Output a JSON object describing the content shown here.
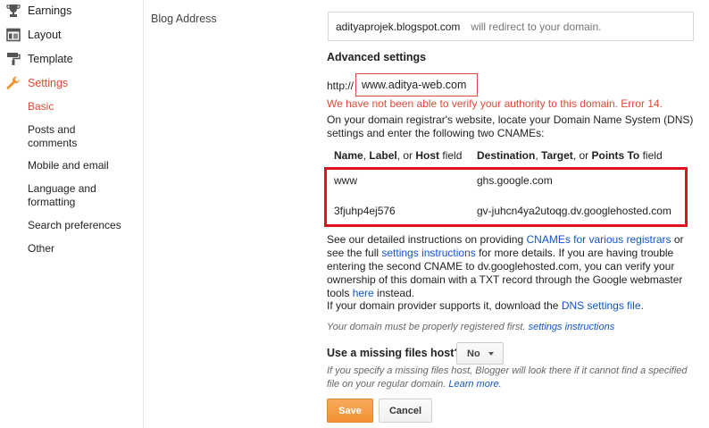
{
  "sidebar": {
    "items": [
      {
        "label": "Earnings",
        "icon": "trophy-icon"
      },
      {
        "label": "Layout",
        "icon": "layout-icon"
      },
      {
        "label": "Template",
        "icon": "paint-roller-icon"
      },
      {
        "label": "Settings",
        "icon": "wrench-icon"
      }
    ],
    "subitems": [
      {
        "label": "Basic"
      },
      {
        "label": "Posts and comments"
      },
      {
        "label": "Mobile and email"
      },
      {
        "label": "Language and formatting"
      },
      {
        "label": "Search preferences"
      },
      {
        "label": "Other"
      }
    ]
  },
  "blog_address": {
    "label": "Blog Address",
    "subdomain": "adityaprojek.blogspot.com",
    "redirect_note": "will redirect to your domain."
  },
  "advanced": {
    "title": "Advanced settings",
    "http_prefix": "http://",
    "domain_value": "www.aditya-web.com",
    "error": "We have not been able to verify your authority to this domain. Error 14.",
    "instructions": "On your domain registrar's website, locate your Domain Name System (DNS) settings and enter the following two CNAMEs:",
    "table": {
      "head_name_b1": "Name",
      "head_name_t1": ", ",
      "head_name_b2": "Label",
      "head_name_t2": ", or ",
      "head_name_b3": "Host",
      "head_name_t3": " field",
      "head_dest_b1": "Destination",
      "head_dest_t1": ", ",
      "head_dest_b2": "Target",
      "head_dest_t2": ", or ",
      "head_dest_b3": "Points To",
      "head_dest_t3": " field",
      "rows": [
        {
          "name": "www",
          "dest": "ghs.google.com"
        },
        {
          "name": "3fjuhp4ej576",
          "dest": "gv-juhcn4ya2utoqg.dv.googlehosted.com"
        }
      ]
    },
    "detail_p1": "See our detailed instructions on providing ",
    "detail_link1": "CNAMEs for various registrars",
    "detail_p2": " or see the full ",
    "detail_link2": "settings instructions",
    "detail_p3": " for more details. If you are having trouble entering the second CNAME to dv.googlehosted.com, you can verify your ownership of this domain with a TXT record through the Google webmaster tools ",
    "detail_link3": "here",
    "detail_p4": " instead.",
    "dns_p1": "If your domain provider supports it, download the ",
    "dns_link": "DNS settings file",
    "dns_p2": ".",
    "registered_note": "Your domain must be properly registered first. ",
    "registered_link": "settings instructions"
  },
  "missing_files": {
    "label": "Use a missing files host?",
    "selected": "No",
    "help": "If you specify a missing files host, Blogger will look there if it cannot find a specified file on your regular domain. ",
    "learn_more": "Learn more."
  },
  "buttons": {
    "save": "Save",
    "cancel": "Cancel"
  },
  "colors": {
    "accent": "#dd4b39",
    "link": "#1155cc",
    "highlight_box": "#e0101e",
    "save_button": "#f39133"
  }
}
